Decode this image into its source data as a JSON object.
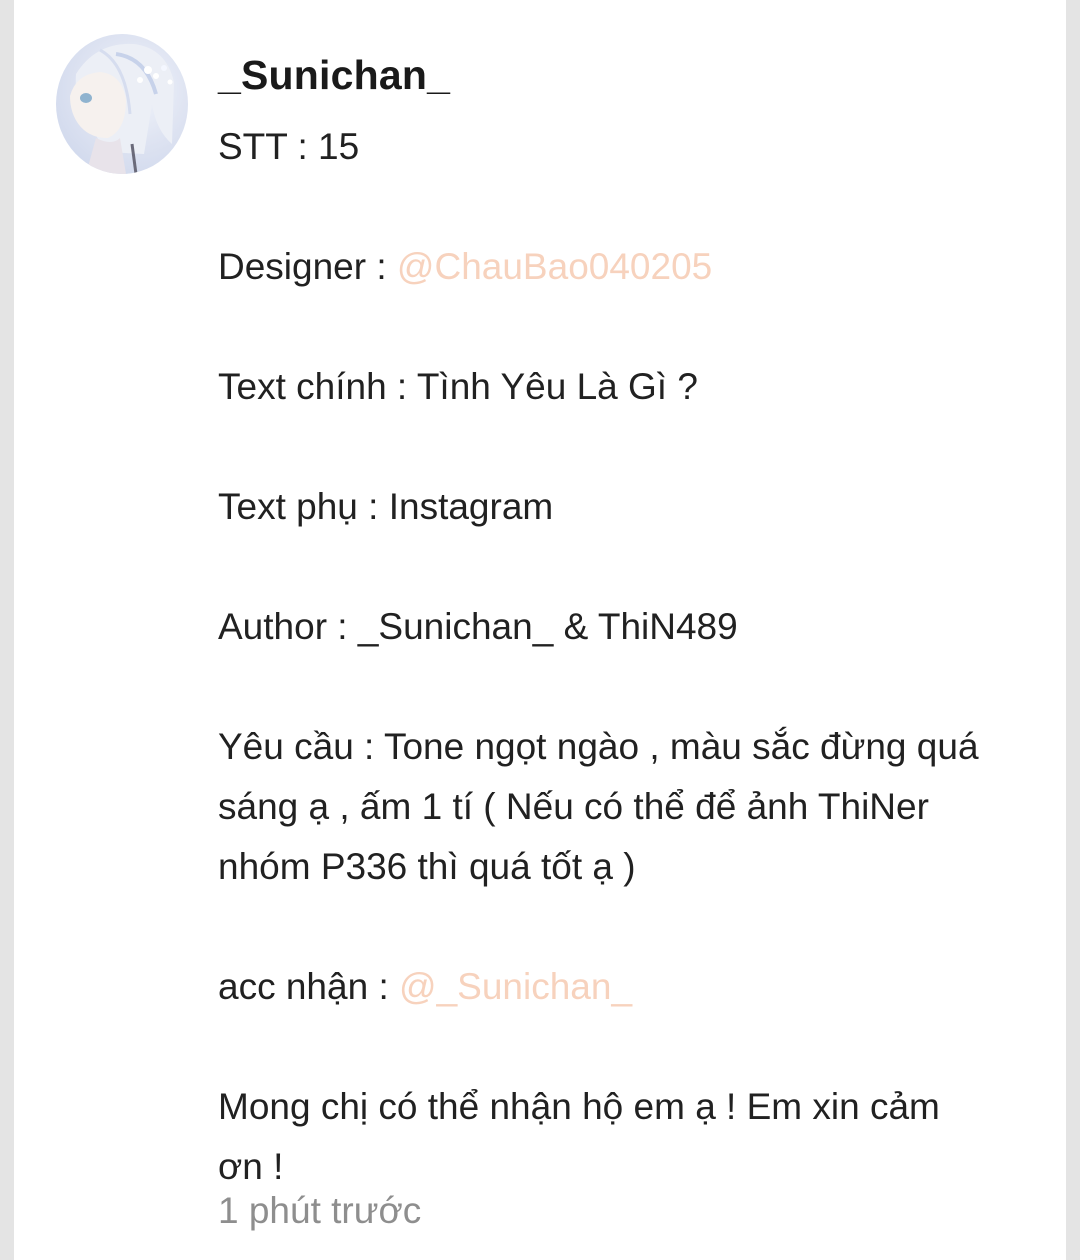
{
  "comment": {
    "username": "_Sunichan_",
    "stt_line": "STT : 15",
    "designer_label": "Designer : ",
    "designer_mention": "@ChauBao040205",
    "main_text_line": "Text chính : Tình Yêu Là Gì ?",
    "sub_text_line": "Text phụ : Instagram",
    "author_line": "Author : _Sunichan_ & ThiN489",
    "request_line_1": "Yêu cầu : Tone ngọt ngào , màu sắc đừng quá",
    "request_line_2": "sáng ạ , ấm 1 tí ( Nếu có thể để ảnh ThiNer",
    "request_line_3": "nhóm P336 thì quá tốt ạ )",
    "receiver_label": "acc nhận : ",
    "receiver_mention": "@_Sunichan_",
    "closing_line_1": "Mong chị có thể nhận hộ em ạ ! Em xin cảm",
    "closing_line_2": "ơn !",
    "timestamp": "1 phút trước"
  },
  "colors": {
    "mention": "#f7d2bd",
    "timestamp": "#8e8e8e",
    "text": "#212121",
    "background": "#e4e4e4"
  }
}
